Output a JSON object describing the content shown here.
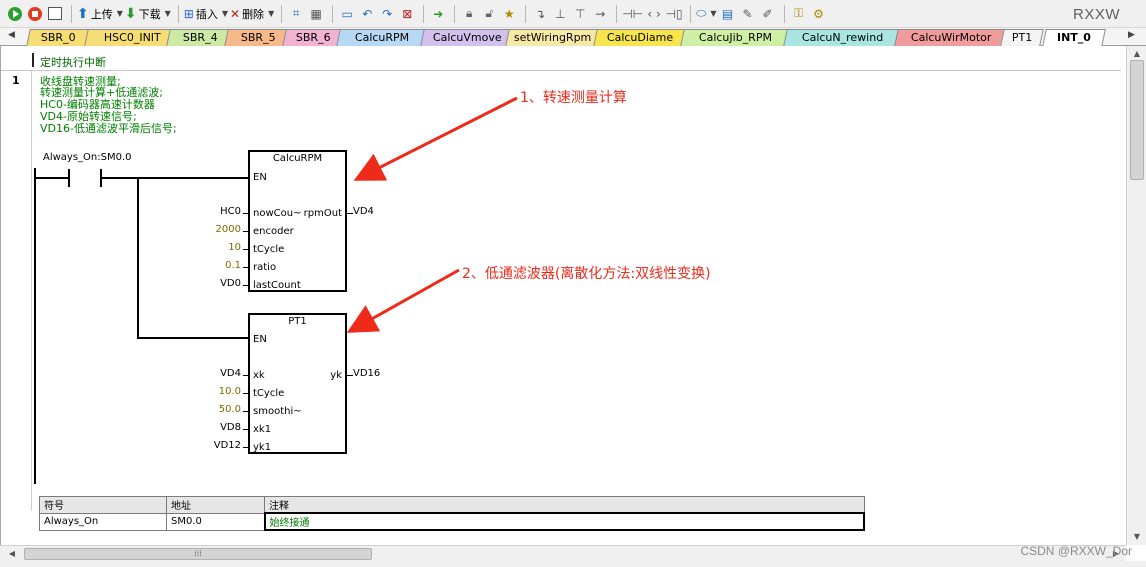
{
  "app": {
    "brand": "RXXW"
  },
  "toolbar": {
    "upload_label": "上传",
    "download_label": "下载",
    "insert_label": "插入",
    "delete_label": "删除"
  },
  "tabs": [
    {
      "label": "SBR_0",
      "color": "#f6de74"
    },
    {
      "label": "HSC0_INIT",
      "color": "#f6de74"
    },
    {
      "label": "SBR_4",
      "color": "#cde9a6"
    },
    {
      "label": "SBR_5",
      "color": "#f7b98a"
    },
    {
      "label": "SBR_6",
      "color": "#f2b3d2"
    },
    {
      "label": "CalcuRPM",
      "color": "#b7d8f2"
    },
    {
      "label": "CalcuVmove",
      "color": "#d4c0ec"
    },
    {
      "label": "setWiringRpm",
      "color": "#f8e8a6"
    },
    {
      "label": "CalcuDiame",
      "color": "#f6e54c"
    },
    {
      "label": "CalcuJib_RPM",
      "color": "#cff0a4"
    },
    {
      "label": "CalcuN_rewind",
      "color": "#a9e6e2"
    },
    {
      "label": "CalcuWirMotor",
      "color": "#f19c9c"
    },
    {
      "label": "PT1",
      "color": "#f4f4f4"
    },
    {
      "label": "INT_0",
      "color": "#ffffff"
    }
  ],
  "routine": {
    "header": "定时执行中断",
    "network_number": "1",
    "comment_lines": [
      "收线盘转速测量;",
      "转速测量计算+低通滤波;",
      "HC0-编码器高速计数器",
      "VD4-原始转速信号;",
      "VD16-低通滤波平滑后信号;"
    ],
    "contact": {
      "label": "Always_On:SM0.0"
    },
    "blocks": {
      "calcurpm": {
        "title": "CalcuRPM",
        "en": "EN",
        "inputs": [
          {
            "name": "nowCou~",
            "value": "HC0",
            "kind": "addr"
          },
          {
            "name": "encoder",
            "value": "2000",
            "kind": "const"
          },
          {
            "name": "tCycle",
            "value": "10",
            "kind": "const"
          },
          {
            "name": "ratio",
            "value": "0.1",
            "kind": "const"
          },
          {
            "name": "lastCount",
            "value": "VD0",
            "kind": "addr"
          }
        ],
        "output": {
          "name": "rpmOut",
          "value": "VD4"
        }
      },
      "pt1": {
        "title": "PT1",
        "en": "EN",
        "inputs": [
          {
            "name": "xk",
            "value": "VD4",
            "kind": "addr"
          },
          {
            "name": "tCycle",
            "value": "10.0",
            "kind": "const"
          },
          {
            "name": "smoothi~",
            "value": "50.0",
            "kind": "const"
          },
          {
            "name": "xk1",
            "value": "VD8",
            "kind": "addr"
          },
          {
            "name": "yk1",
            "value": "VD12",
            "kind": "addr"
          }
        ],
        "output": {
          "name": "yk",
          "value": "VD16"
        }
      }
    }
  },
  "annotations": [
    {
      "text": "1、转速测量计算",
      "color": "#ee2a1a"
    },
    {
      "text": "2、低通滤波器(离散化方法:双线性变换)",
      "color": "#ee2a1a"
    }
  ],
  "symbol_table": {
    "headers": [
      "符号",
      "地址",
      "注释"
    ],
    "rows": [
      {
        "symbol": "Always_On",
        "address": "SM0.0",
        "comment": "始终接通"
      }
    ]
  },
  "watermark": "CSDN @RXXW_Dor"
}
